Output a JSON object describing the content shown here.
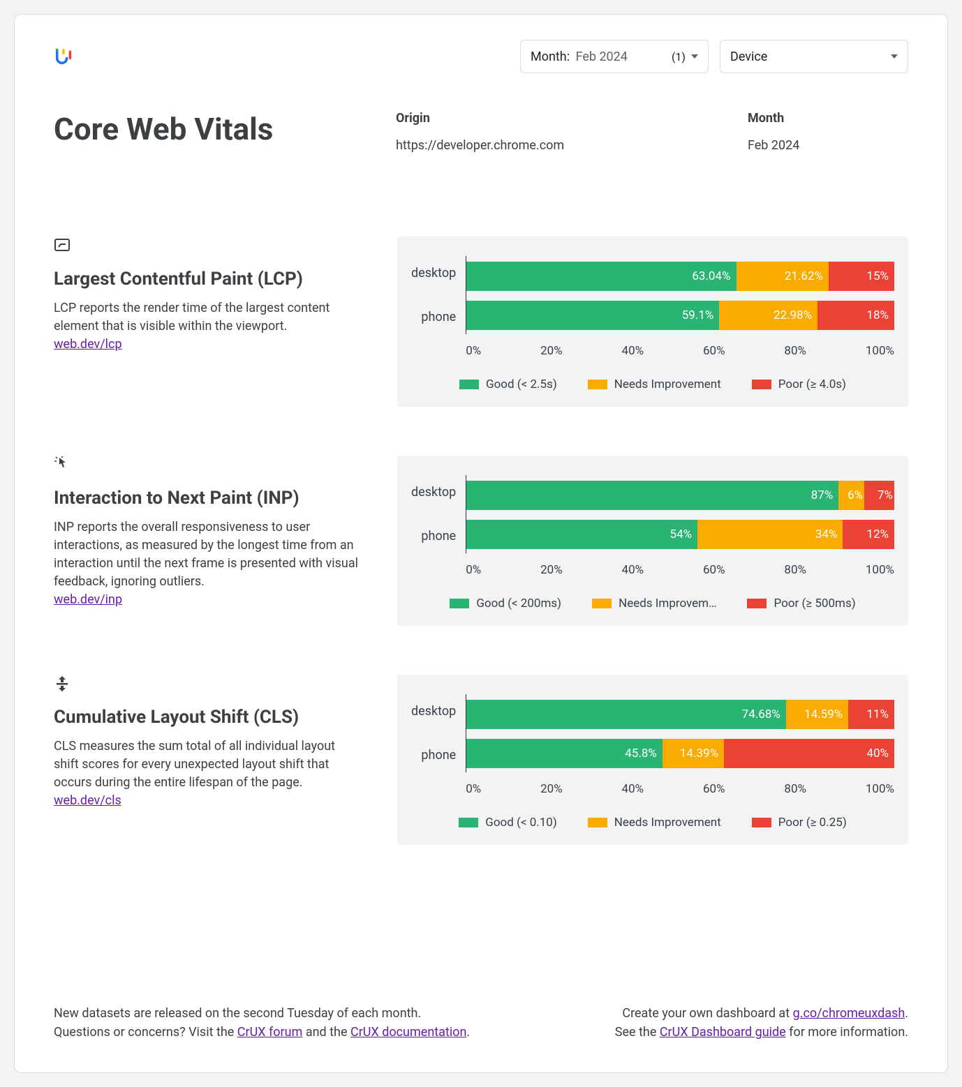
{
  "filters": {
    "month_label": "Month",
    "month_value": "Feb 2024",
    "month_count": "(1)",
    "device_label": "Device"
  },
  "page_title": "Core Web Vitals",
  "origin_label": "Origin",
  "origin_value": "https://developer.chrome.com",
  "month_label": "Month",
  "month_value": "Feb 2024",
  "axis": {
    "t0": "0%",
    "t1": "20%",
    "t2": "40%",
    "t3": "60%",
    "t4": "80%",
    "t5": "100%"
  },
  "colors": {
    "good": "#29b474",
    "ni": "#f9ab00",
    "poor": "#ea4335"
  },
  "chart_data": [
    {
      "type": "bar",
      "metric": "LCP",
      "categories": [
        "desktop",
        "phone"
      ],
      "series": [
        {
          "name": "Good (< 2.5s)",
          "values": [
            63.04,
            59.1
          ]
        },
        {
          "name": "Needs Improvement",
          "values": [
            21.62,
            22.98
          ]
        },
        {
          "name": "Poor (≥ 4.0s)",
          "values": [
            15,
            18
          ]
        }
      ],
      "xlim": [
        0,
        100
      ],
      "stacked": true,
      "orientation": "horizontal"
    },
    {
      "type": "bar",
      "metric": "INP",
      "categories": [
        "desktop",
        "phone"
      ],
      "series": [
        {
          "name": "Good (< 200ms)",
          "values": [
            87,
            54
          ]
        },
        {
          "name": "Needs Improvement",
          "values": [
            6,
            34
          ]
        },
        {
          "name": "Poor (≥ 500ms)",
          "values": [
            7,
            12
          ]
        }
      ],
      "xlim": [
        0,
        100
      ],
      "stacked": true,
      "orientation": "horizontal"
    },
    {
      "type": "bar",
      "metric": "CLS",
      "categories": [
        "desktop",
        "phone"
      ],
      "series": [
        {
          "name": "Good (< 0.10)",
          "values": [
            74.68,
            45.8
          ]
        },
        {
          "name": "Needs Improvement",
          "values": [
            14.59,
            14.39
          ]
        },
        {
          "name": "Poor (≥ 0.25)",
          "values": [
            11,
            40
          ]
        }
      ],
      "xlim": [
        0,
        100
      ],
      "stacked": true,
      "orientation": "horizontal"
    }
  ],
  "lcp": {
    "title": "Largest Contentful Paint (LCP)",
    "desc": "LCP reports the render time of the largest content element that is visible within the viewport.",
    "link": "web.dev/lcp",
    "cat0": "desktop",
    "cat1": "phone",
    "d_good": "63.04%",
    "d_ni": "21.62%",
    "d_poor": "15%",
    "p_good": "59.1%",
    "p_ni": "22.98%",
    "p_poor": "18%",
    "leg_good": "Good (< 2.5s)",
    "leg_ni": "Needs Improvement",
    "leg_poor": "Poor (≥ 4.0s)"
  },
  "inp": {
    "title": "Interaction to Next Paint (INP)",
    "desc": "INP reports the overall responsiveness to user interactions, as measured by the longest time from an interaction until the next frame is presented with visual feedback, ignoring outliers.",
    "link": "web.dev/inp",
    "cat0": "desktop",
    "cat1": "phone",
    "d_good": "87%",
    "d_ni": "6%",
    "d_poor": "7%",
    "p_good": "54%",
    "p_ni": "34%",
    "p_poor": "12%",
    "leg_good": "Good (< 200ms)",
    "leg_ni": "Needs Improvem…",
    "leg_poor": "Poor (≥ 500ms)"
  },
  "cls": {
    "title": "Cumulative Layout Shift (CLS)",
    "desc": "CLS measures the sum total of all individual layout shift scores for every unexpected layout shift that occurs during the entire lifespan of the page.",
    "link": "web.dev/cls",
    "cat0": "desktop",
    "cat1": "phone",
    "d_good": "74.68%",
    "d_ni": "14.59%",
    "d_poor": "11%",
    "p_good": "45.8%",
    "p_ni": "14.39%",
    "p_poor": "40%",
    "leg_good": "Good (< 0.10)",
    "leg_ni": "Needs Improvement",
    "leg_poor": "Poor (≥ 0.25)"
  },
  "footer": {
    "left1": "New datasets are released on the second Tuesday of each month.",
    "left2a": "Questions or concerns? Visit the ",
    "left2_link1": "CrUX forum",
    "left2b": " and the ",
    "left2_link2": "CrUX documentation",
    "left2c": ".",
    "right1a": "Create your own dashboard at ",
    "right1_link": "g.co/chromeuxdash",
    "right1b": ".",
    "right2a": "See the ",
    "right2_link": "CrUX Dashboard guide",
    "right2b": " for more information."
  }
}
